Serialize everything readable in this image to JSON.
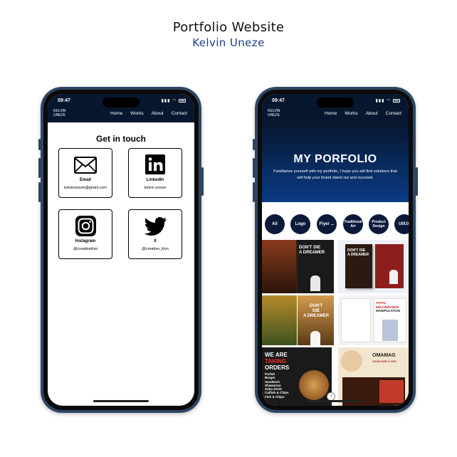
{
  "header": {
    "title": "Portfolio Website",
    "subtitle": "Kelvin Uneze"
  },
  "status_bar": {
    "time": "09:47"
  },
  "site_nav": {
    "brand_line1": "KELVIN",
    "brand_line2": "UNEZE",
    "items": [
      "Home",
      "Works",
      "About",
      "Contact"
    ]
  },
  "contact_page": {
    "heading": "Get in touch",
    "cards": [
      {
        "label": "Email",
        "value": "kelvinuneze@gmail.com",
        "icon": "envelope-icon"
      },
      {
        "label": "LinkedIn",
        "value": "kelvin uneze",
        "icon": "linkedin-icon"
      },
      {
        "label": "Instagram",
        "value": "@creativeklvn",
        "icon": "instagram-icon"
      },
      {
        "label": "X",
        "value": "@creative_klvn",
        "icon": "twitter-bird-icon"
      }
    ]
  },
  "portfolio_page": {
    "title": "MY PORFOLIO",
    "intro": "Familiarize yourself with my portfolio, I hope you will find solutions that will help your brand stand out and succeed.",
    "filters": [
      "All",
      "Logo",
      "Flyer ...",
      "Traditional Art",
      "Product Design",
      "UI/UX"
    ],
    "gallery": [
      {
        "caption_lines": [
          "DON'T DIE",
          "A DREAMER"
        ]
      },
      {
        "caption_lines": [
          "DON'T DIE",
          "A DREAMER"
        ]
      },
      {
        "caption_lines": []
      },
      {
        "caption_lines": [
          "DON'T",
          "DIE",
          "A DREAMER"
        ]
      },
      {
        "caption_lines": [
          "TOTAL DELIVERANCE",
          "MANIPULATION"
        ]
      },
      {
        "caption_lines": [
          "WE ARE",
          "TAKING",
          "ORDERS",
          "Parfait",
          "Burger",
          "Sandwich",
          "Shawarma",
          "Zobo Drink",
          "Catfish & Chips",
          "Fish & Chips"
        ]
      },
      {
        "caption_lines": [
          "OMAMAG",
          "SKINCARE & SPA"
        ]
      }
    ]
  },
  "colors": {
    "nav_bg": "#07172f",
    "hero_bottom": "#0a3b85",
    "subtitle": "#1d3f8f",
    "phone_frame": "#2f4766",
    "chip": "#0b1a3a"
  }
}
